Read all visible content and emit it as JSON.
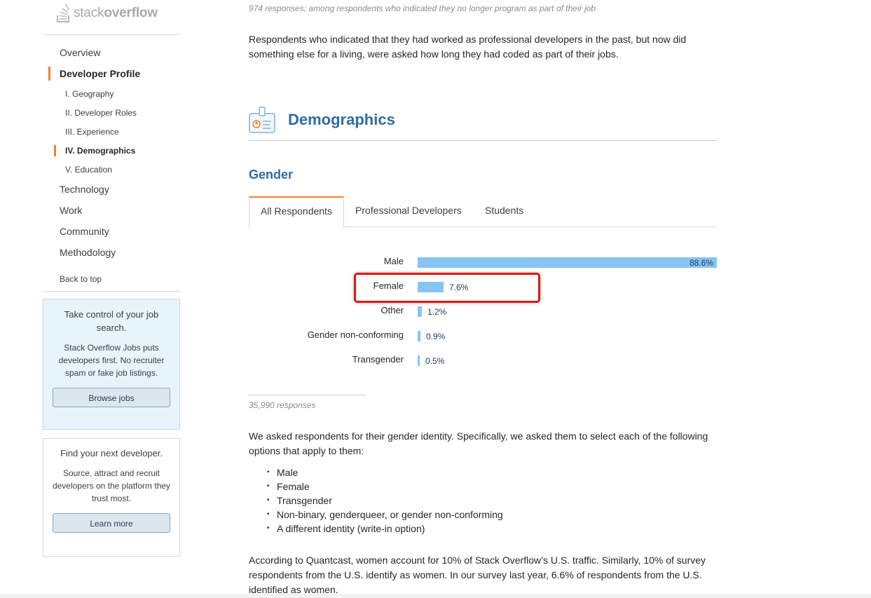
{
  "brand": {
    "logo_light": "stack",
    "logo_bold": "overflow"
  },
  "sidebar": {
    "items": [
      {
        "label": "Overview"
      },
      {
        "label": "Developer Profile"
      },
      {
        "label": "Technology"
      },
      {
        "label": "Work"
      },
      {
        "label": "Community"
      },
      {
        "label": "Methodology"
      }
    ],
    "subitems": [
      {
        "label": "I. Geography"
      },
      {
        "label": "II. Developer Roles"
      },
      {
        "label": "III. Experience"
      },
      {
        "label": "IV. Demographics"
      },
      {
        "label": "V. Education"
      }
    ],
    "back_to_top": "Back to top",
    "promos": [
      {
        "title": "Take control of your job search.",
        "body": "Stack Overflow Jobs puts developers first. No recruiter spam or fake job listings.",
        "button": "Browse jobs"
      },
      {
        "title": "Find your next developer.",
        "body": "Source, attract and recruit developers on the platform they trust most.",
        "button": "Learn more"
      }
    ]
  },
  "main": {
    "top_note": "974 responses; among respondents who indicated they no longer program as part of their job",
    "intro": "Respondents who indicated that they had worked as professional developers in the past, but now did something else for a living, were asked how long they had coded as part of their jobs.",
    "section_title": "Demographics",
    "gender_title": "Gender",
    "tabs": [
      {
        "label": "All Respondents",
        "active": true
      },
      {
        "label": "Professional Developers",
        "active": false
      },
      {
        "label": "Students",
        "active": false
      }
    ],
    "responses": "35,990 responses",
    "question": "We asked respondents for their gender identity. Specifically, we asked them to select each of the following options that apply to them:",
    "options": [
      "Male",
      "Female",
      "Transgender",
      "Non-binary, genderqueer, or gender non-conforming",
      "A different identity (write-in option)"
    ],
    "closing": "According to Quantcast, women account for 10% of Stack Overflow’s U.S. traffic. Similarly, 10% of survey respondents from the U.S. identify as women. In our survey last year, 6.6% of respondents from the U.S. identified as women."
  },
  "chart_data": {
    "type": "bar",
    "orientation": "horizontal",
    "categories": [
      "Male",
      "Female",
      "Other",
      "Gender non-conforming",
      "Transgender"
    ],
    "values": [
      88.6,
      7.6,
      1.2,
      0.9,
      0.5
    ],
    "value_labels": [
      "88.6%",
      "7.6%",
      "1.2%",
      "0.9%",
      "0.5%"
    ],
    "xlim": [
      0,
      88.6
    ],
    "bar_color": "#86c5f3",
    "highlighted_category": "Female"
  },
  "colors": {
    "accent": "#f48024",
    "heading": "#2d6ca2",
    "highlight": "#e21717"
  }
}
